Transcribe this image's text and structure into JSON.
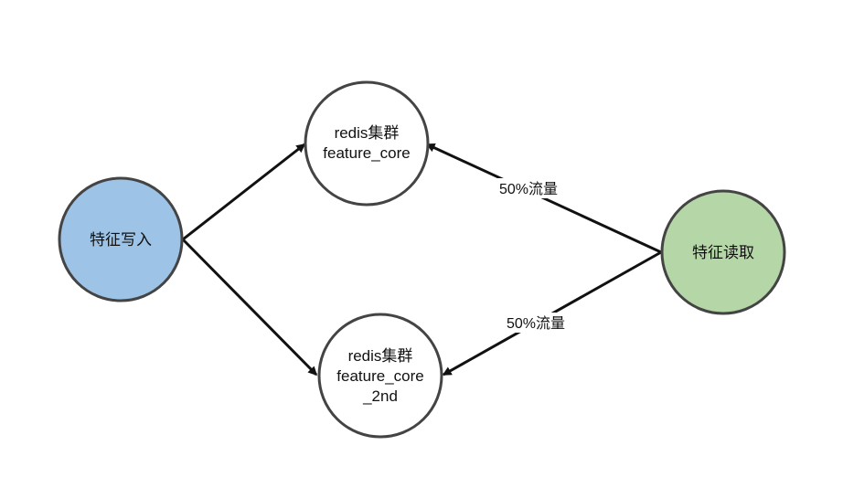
{
  "nodes": {
    "write": {
      "label": "特征写入",
      "fill": "#9dc3e6"
    },
    "cluster_core": {
      "lines": [
        "redis集群",
        "feature_core"
      ],
      "fill": "#ffffff"
    },
    "cluster_core_2nd": {
      "lines": [
        "redis集群",
        "feature_core",
        "_2nd"
      ],
      "fill": "#ffffff"
    },
    "read": {
      "label": "特征读取",
      "fill": "#b5d6a7"
    }
  },
  "edges": {
    "read_to_core": {
      "label": "50%流量"
    },
    "read_to_core_2nd": {
      "label": "50%流量"
    }
  },
  "colors": {
    "stroke": "#444444",
    "arrow": "#111111"
  }
}
